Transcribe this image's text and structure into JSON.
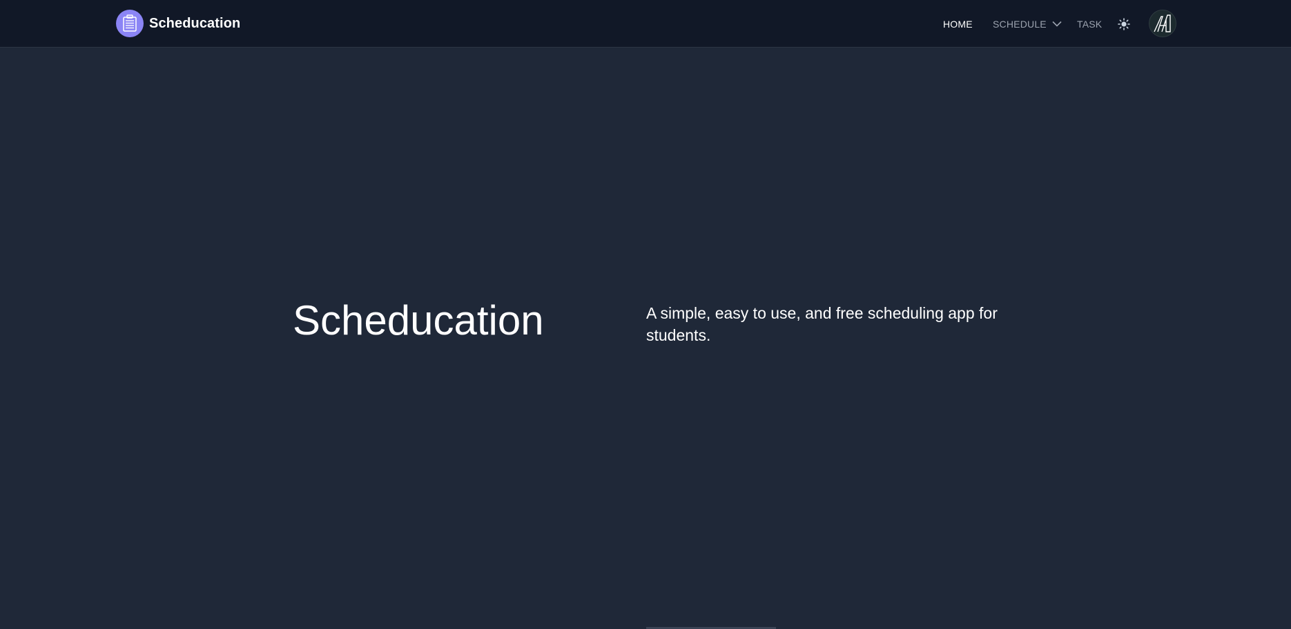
{
  "app": {
    "brand_name": "Scheducation",
    "brand_icon": "clipboard-icon",
    "brand_color": "#8b85f5"
  },
  "nav": {
    "items": [
      {
        "label": "HOME",
        "active": true
      },
      {
        "label": "SCHEDULE",
        "active": false,
        "has_dropdown": true
      },
      {
        "label": "TASK",
        "active": false
      }
    ],
    "theme_icon": "sun-icon",
    "avatar_icon": "profile-logo"
  },
  "hero": {
    "title": "Scheducation",
    "subtitle": "A simple, easy to use, and free scheduling app for students."
  },
  "colors": {
    "background": "#1f2838",
    "navbar": "#111827",
    "text": "#ffffff",
    "muted": "#9ca3af"
  }
}
